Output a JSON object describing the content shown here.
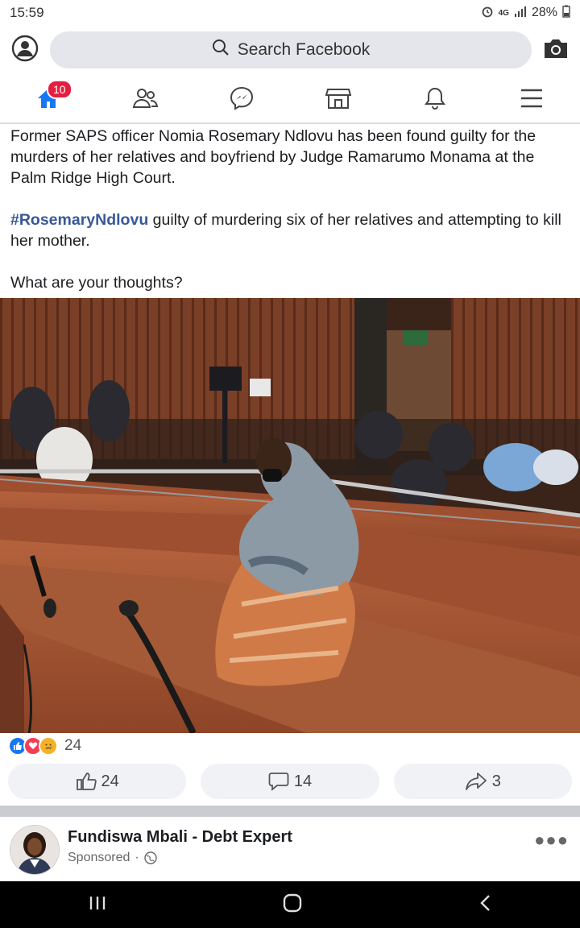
{
  "status": {
    "time": "15:59",
    "network": "4G",
    "battery": "28%"
  },
  "search": {
    "placeholder": "Search Facebook"
  },
  "nav": {
    "home_badge": "10"
  },
  "post": {
    "paragraph1": "Former SAPS officer Nomia Rosemary Ndlovu has been found guilty for the murders of her relatives and boyfriend by Judge Ramarumo Monama at the Palm Ridge High Court.",
    "hashtag": "#RosemaryNdlovu",
    "paragraph2_rest": " guilty of murdering six of her relatives and attempting to kill her mother.",
    "paragraph3": "What are your thoughts?",
    "reaction_count": "24",
    "like_count": "24",
    "comment_count": "14",
    "share_count": "3"
  },
  "sponsored": {
    "name": "Fundiswa Mbali - Debt Expert",
    "label": "Sponsored",
    "dot": "·"
  },
  "colors": {
    "brand": "#1877f2",
    "badge": "#e41e3f",
    "hashtag": "#385898",
    "love": "#f33e58",
    "sad": "#f7b125"
  },
  "icons": [
    "profile-icon",
    "search-icon",
    "camera-icon",
    "home-icon",
    "friends-icon",
    "messenger-icon",
    "marketplace-icon",
    "bell-icon",
    "menu-icon",
    "like-icon",
    "comment-icon",
    "share-icon",
    "globe-icon",
    "more-icon",
    "recents-icon",
    "home-button-icon",
    "back-icon"
  ]
}
